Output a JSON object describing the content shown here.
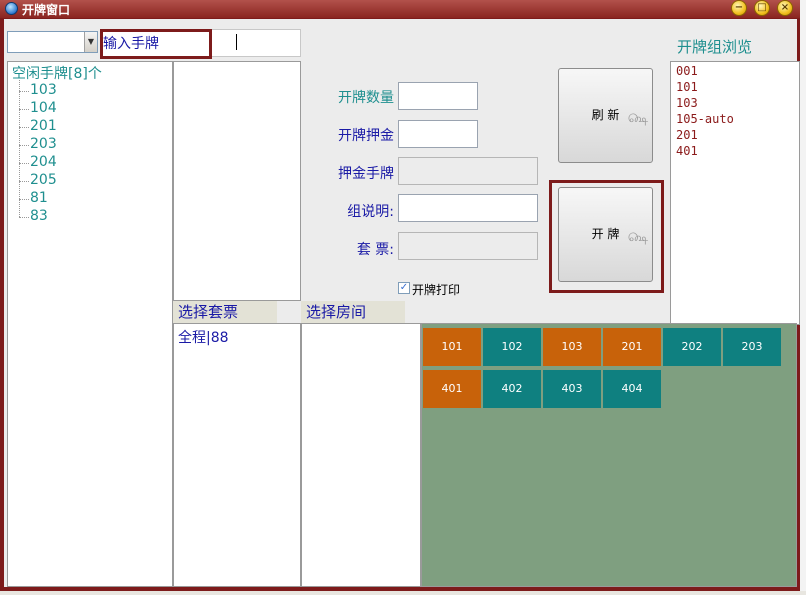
{
  "window": {
    "title": "开牌窗口",
    "controls": {
      "minimize": "−",
      "maximize": "□",
      "close": "×"
    }
  },
  "hand_input": {
    "label": "输入手牌",
    "value": ""
  },
  "combo": {
    "value": ""
  },
  "free_tree": {
    "root_label": "空闲手牌[8]个",
    "items": [
      "103",
      "104",
      "201",
      "203",
      "204",
      "205",
      "81",
      "83"
    ]
  },
  "form": {
    "count_label": "开牌数量",
    "deposit_label": "开牌押金",
    "deposit_hand_label": "押金手牌",
    "group_note_label": "组说明:",
    "package_label": "套 票:"
  },
  "buttons": {
    "refresh": "刷 新",
    "open": "开 牌"
  },
  "print_option": {
    "label": "开牌打印",
    "checked": true
  },
  "browse": {
    "title": "开牌组浏览",
    "items": [
      "001",
      "101",
      "103",
      "105-auto",
      "201",
      "401"
    ]
  },
  "package_section": {
    "title": "选择套票",
    "items": [
      "全程|88"
    ]
  },
  "room_section": {
    "title": "选择房间"
  },
  "rooms": [
    {
      "name": "101",
      "status": "orange"
    },
    {
      "name": "102",
      "status": "teal"
    },
    {
      "name": "103",
      "status": "orange"
    },
    {
      "name": "201",
      "status": "orange"
    },
    {
      "name": "202",
      "status": "teal"
    },
    {
      "name": "203",
      "status": "teal"
    },
    {
      "name": "401",
      "status": "orange"
    },
    {
      "name": "402",
      "status": "teal"
    },
    {
      "name": "403",
      "status": "teal"
    },
    {
      "name": "404",
      "status": "teal"
    }
  ],
  "colors": {
    "frame": "#7d1b1b",
    "orange_room": "#c8620a",
    "teal_room": "#0f8080",
    "grid_bg": "#7f9f80",
    "label_blue": "#1a1aa6",
    "tree_teal": "#1f8f8f"
  }
}
